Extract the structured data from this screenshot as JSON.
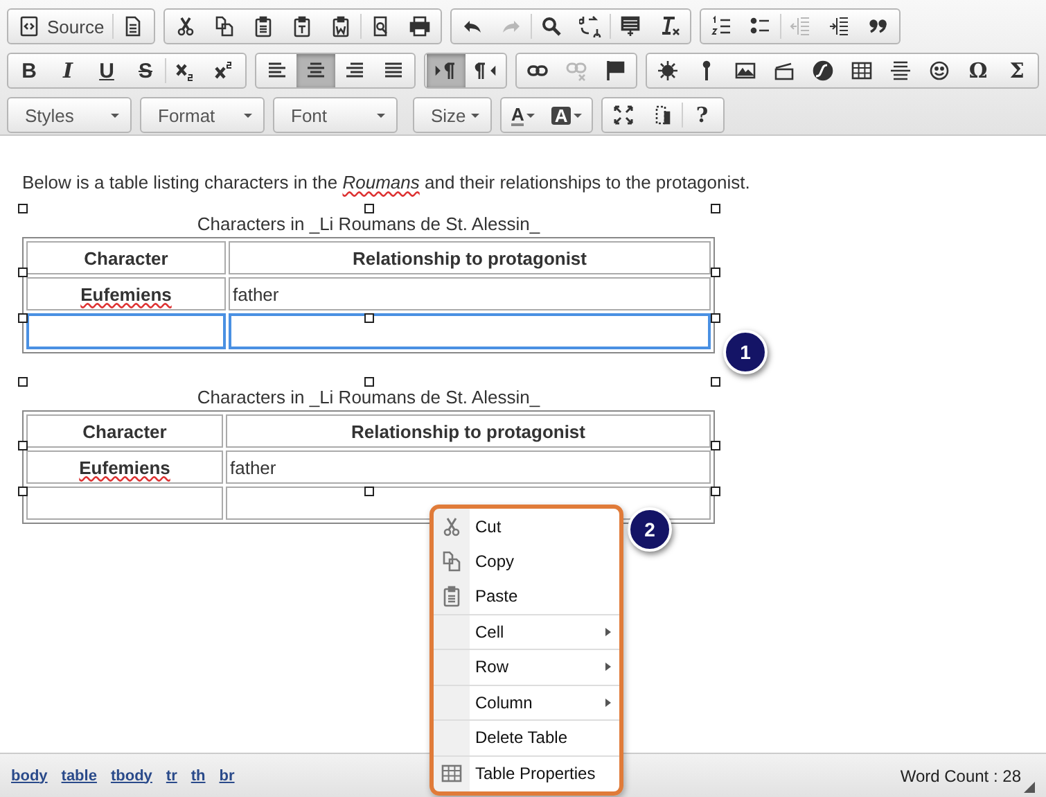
{
  "toolbar": {
    "rows": [
      {
        "groups": [
          {
            "kind": "buttons",
            "buttons": [
              {
                "label": "Source"
              },
              {
                "disabled": false
              }
            ]
          },
          {
            "kind": "buttons",
            "buttons": [
              {
                "disabled": false
              },
              {
                "disabled": false
              },
              {
                "disabled": false
              },
              {
                "disabled": false
              },
              {
                "disabled": false
              },
              {
                "disabled": false
              },
              {
                "disabled": false
              }
            ]
          },
          {
            "kind": "buttons",
            "buttons": [
              {
                "disabled": false
              },
              {
                "disabled": true
              },
              {
                "disabled": false
              },
              {
                "disabled": false
              },
              {
                "disabled": false
              },
              {
                "disabled": false
              }
            ]
          },
          {
            "kind": "buttons",
            "buttons": [
              {
                "disabled": false
              },
              {
                "disabled": false
              },
              {
                "disabled": true
              },
              {
                "disabled": false
              },
              {
                "disabled": false
              }
            ]
          }
        ]
      },
      {
        "groups": [
          {
            "kind": "buttons",
            "buttons": [
              {
                "glyph": "B"
              },
              {
                "glyph": "I"
              },
              {
                "glyph": "U"
              },
              {
                "glyph": "S"
              },
              {
                "disabled": false
              },
              {
                "disabled": false
              }
            ]
          },
          {
            "kind": "buttons",
            "buttons": [
              {
                "selected": false
              },
              {
                "selected": true
              },
              {
                "selected": false
              },
              {
                "selected": false
              }
            ]
          },
          {
            "kind": "buttons",
            "buttons": [
              {
                "selected": true
              },
              {
                "selected": false
              }
            ]
          },
          {
            "kind": "buttons",
            "buttons": [
              {
                "disabled": false
              },
              {
                "disabled": true
              },
              {
                "disabled": false
              }
            ]
          },
          {
            "kind": "buttons",
            "buttons": [
              {
                "disabled": false
              },
              {
                "disabled": false
              },
              {
                "disabled": false
              },
              {
                "disabled": false
              },
              {
                "disabled": false
              },
              {
                "disabled": false
              },
              {
                "disabled": false
              },
              {
                "disabled": false
              },
              {
                "glyph": "Ω"
              },
              {
                "glyph": "Σ"
              }
            ]
          }
        ]
      },
      {
        "groups": [
          {
            "kind": "combo",
            "label": "Styles"
          },
          {
            "kind": "combo",
            "label": "Format"
          },
          {
            "kind": "combo",
            "label": "Font"
          },
          {
            "kind": "combo",
            "label": "Size"
          },
          {
            "kind": "buttons",
            "buttons": [
              {
                "glyph": "A"
              },
              {
                "glyph": "A"
              }
            ]
          },
          {
            "kind": "buttons",
            "buttons": [
              {
                "disabled": false
              },
              {
                "disabled": false
              },
              {
                "glyph": "?"
              }
            ]
          }
        ]
      }
    ]
  },
  "content": {
    "intro": "Below is a table listing characters in the *Roumans* and their relationships to the protagonist.",
    "tables": [
      {
        "caption": "Characters in _Li Roumans de St. Alessin_",
        "headers": [
          "Character",
          "Relationship to protagonist"
        ],
        "rows": [
          {
            "cells": [
              "Eufemiens",
              "father"
            ],
            "selected": false
          }
        ],
        "blank_row": {
          "selected": true
        }
      },
      {
        "caption": "Characters in _Li Roumans de St. Alessin_",
        "headers": [
          "Character",
          "Relationship to protagonist"
        ],
        "rows": [
          {
            "cells": [
              "Eufemiens",
              "father"
            ],
            "selected": false
          }
        ],
        "blank_row": {
          "selected": false
        }
      }
    ]
  },
  "callouts": [
    "1",
    "2"
  ],
  "context_menu": {
    "items": [
      {
        "label": "Cut",
        "kind": "action"
      },
      {
        "label": "Copy",
        "kind": "action"
      },
      {
        "label": "Paste",
        "kind": "action"
      },
      {
        "label": "Cell",
        "kind": "submenu"
      },
      {
        "label": "Row",
        "kind": "submenu"
      },
      {
        "label": "Column",
        "kind": "submenu"
      },
      {
        "label": "Delete Table",
        "kind": "action"
      },
      {
        "label": "Table Properties",
        "kind": "action"
      }
    ]
  },
  "status_bar": {
    "path": [
      "body",
      "table",
      "tbody",
      "tr",
      "th",
      "br"
    ],
    "word_count": "Word Count : 28"
  }
}
